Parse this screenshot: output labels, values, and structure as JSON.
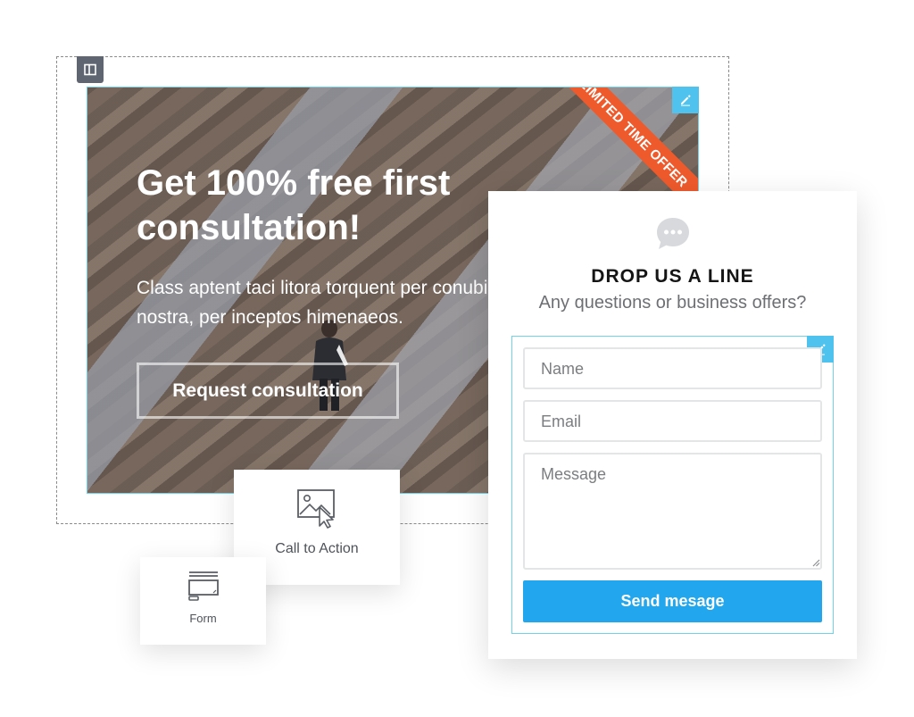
{
  "hero": {
    "ribbon": "LIMITED TIME OFFER",
    "title": "Get 100% free first consultation!",
    "text": "Class aptent taci litora torquent per conubia nostra, per inceptos himenaeos.",
    "button_label": "Request consultation"
  },
  "widgets": {
    "cta_label": "Call to Action",
    "form_label": "Form"
  },
  "contact": {
    "title": "DROP US A LINE",
    "subtitle": "Any questions or business offers?",
    "name_placeholder": "Name",
    "email_placeholder": "Email",
    "message_placeholder": "Message",
    "send_label": "Send mesage"
  },
  "icons": {
    "section_handle": "columns-icon",
    "edit": "pencil-icon",
    "chat": "chat-bubble-icon",
    "cta": "image-cursor-icon",
    "form": "form-icon"
  },
  "colors": {
    "accent": "#22a6ee",
    "edit_badge": "#4fc3ee",
    "ribbon": "#ef5a2c",
    "selection_outline": "#6fd3ea"
  }
}
